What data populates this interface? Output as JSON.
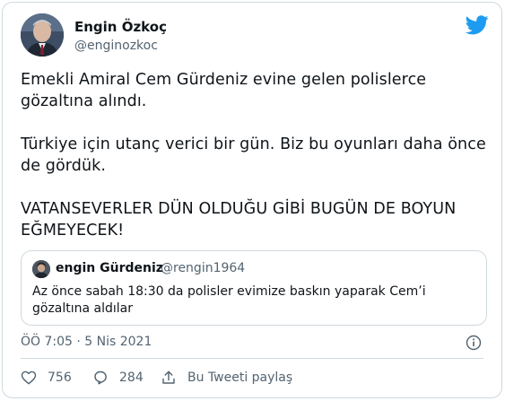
{
  "author": {
    "name": "Engin Özkoç",
    "handle": "@enginozkoc"
  },
  "tweet": {
    "paragraphs": [
      "Emekli Amiral Cem Gürdeniz evine gelen polislerce gözaltına alındı.",
      "Türkiye için utanç verici bir gün. Biz bu oyunları daha önce de gördük.",
      "VATANSEVERLER DÜN OLDUĞU GİBİ BUGÜN DE BOYUN EĞMEYECEK!"
    ],
    "timestamp": "ÖÖ 7:05 · 5 Nis 2021"
  },
  "quoted_tweet": {
    "name": "engin Gürdeniz",
    "handle": "@rengin1964",
    "text": "Az önce sabah 18:30 da polisler evimize baskın yaparak Cem’i gözaltına aldılar"
  },
  "actions": {
    "likes": "756",
    "replies": "284",
    "share_label": "Bu Tweeti paylaş"
  },
  "icons": {
    "bird": "twitter-bird-icon",
    "info": "info-icon",
    "like": "heart-icon",
    "reply": "reply-icon",
    "share": "share-icon"
  },
  "colors": {
    "brand": "#1d9bf0",
    "secondary_text": "#536471",
    "border": "#cfd9de"
  }
}
